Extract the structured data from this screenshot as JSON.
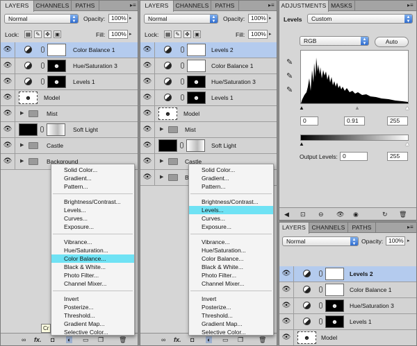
{
  "panel1": {
    "tabs": [
      "LAYERS",
      "CHANNELS",
      "PATHS"
    ],
    "blend_mode": "Normal",
    "opacity_label": "Opacity:",
    "opacity_value": "100%",
    "lock_label": "Lock:",
    "fill_label": "Fill:",
    "fill_value": "100%",
    "layers": [
      "Color Balance 1",
      "Hue/Saturation 3",
      "Levels 1",
      "Model",
      "Mist",
      "Soft Light",
      "Castle",
      "Background"
    ],
    "tooltip": "Cr"
  },
  "panel2": {
    "tabs": [
      "LAYERS",
      "CHANNELS",
      "PATHS"
    ],
    "blend_mode": "Normal",
    "opacity_label": "Opacity:",
    "opacity_value": "100%",
    "lock_label": "Lock:",
    "fill_label": "Fill:",
    "fill_value": "100%",
    "layers": [
      "Levels 2",
      "Color Balance 1",
      "Hue/Saturation 3",
      "Levels 1",
      "Model",
      "Mist",
      "Soft Light",
      "Castle",
      "Ba"
    ]
  },
  "menu_items": [
    "Solid Color...",
    "Gradient...",
    "Pattern...",
    "Brightness/Contrast...",
    "Levels...",
    "Curves...",
    "Exposure...",
    "Vibrance...",
    "Hue/Saturation...",
    "Color Balance...",
    "Black & White...",
    "Photo Filter...",
    "Channel Mixer...",
    "Invert",
    "Posterize...",
    "Threshold...",
    "Gradient Map...",
    "Selective Color..."
  ],
  "adjustments": {
    "tabs": [
      "ADJUSTMENTS",
      "MASKS"
    ],
    "title": "Levels",
    "preset": "Custom",
    "channel": "RGB",
    "auto_label": "Auto",
    "input_black": "0",
    "input_gray": "0.91",
    "input_white": "255",
    "output_label": "Output Levels:",
    "output_black": "0",
    "output_white": "255"
  },
  "panel3": {
    "tabs": [
      "LAYERS",
      "CHANNELS",
      "PATHS"
    ],
    "blend_mode": "Normal",
    "opacity_label": "Opacity:",
    "opacity_value": "100%",
    "layers": [
      "Levels 2",
      "Color Balance 1",
      "Hue/Saturation 3",
      "Levels 1",
      "Model"
    ]
  },
  "bottom_icons": [
    "link-icon",
    "fx-icon",
    "mask-icon",
    "adjustment-icon",
    "folder-icon",
    "new-layer-icon",
    "trash-icon"
  ],
  "colors": {
    "selected_row": "#b4cbee",
    "menu_highlight": "#6fe2f4",
    "panel_bg": "#d6d6d6"
  }
}
